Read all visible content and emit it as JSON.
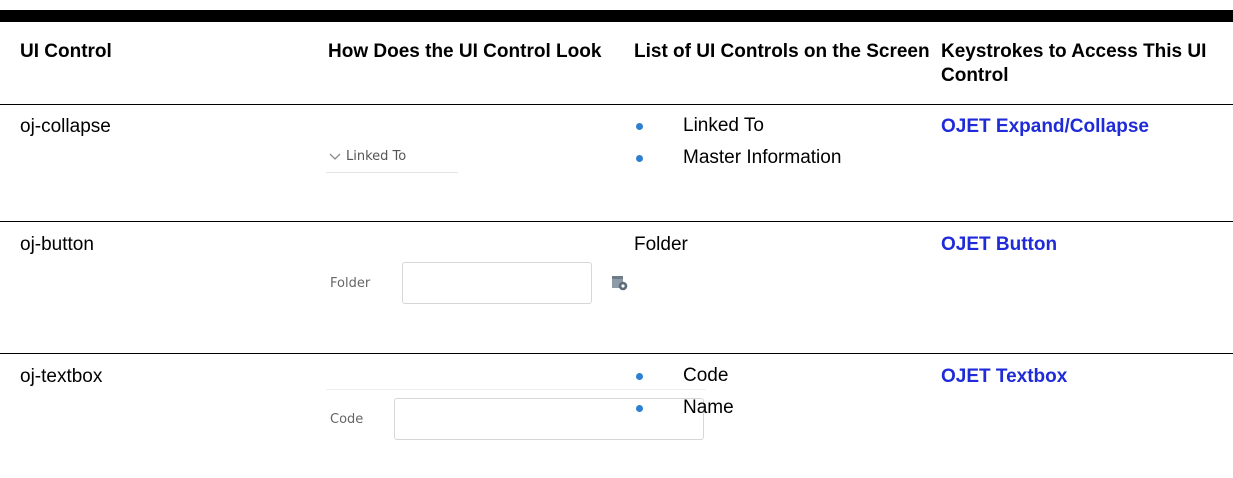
{
  "headers": [
    "UI Control",
    "How Does the UI Control Look",
    "List of UI Controls on the Screen",
    "Keystrokes to Access This UI Control"
  ],
  "rows": [
    {
      "control": "oj-collapse",
      "mock": {
        "label": "Linked To",
        "icon": "chevron-down-icon"
      },
      "list": [
        "Linked To",
        "Master Information"
      ],
      "link": "OJET Expand/Collapse"
    },
    {
      "control": "oj-button",
      "mock": {
        "label": "Folder",
        "icon": "folder-settings-icon"
      },
      "list_text": "Folder",
      "link": "OJET Button"
    },
    {
      "control": "oj-textbox",
      "mock": {
        "label": "Code"
      },
      "list": [
        "Code",
        "Name"
      ],
      "link": "OJET Textbox"
    }
  ],
  "colors": {
    "link": "#1f2bd8",
    "bullet": "#2f7fd0"
  }
}
